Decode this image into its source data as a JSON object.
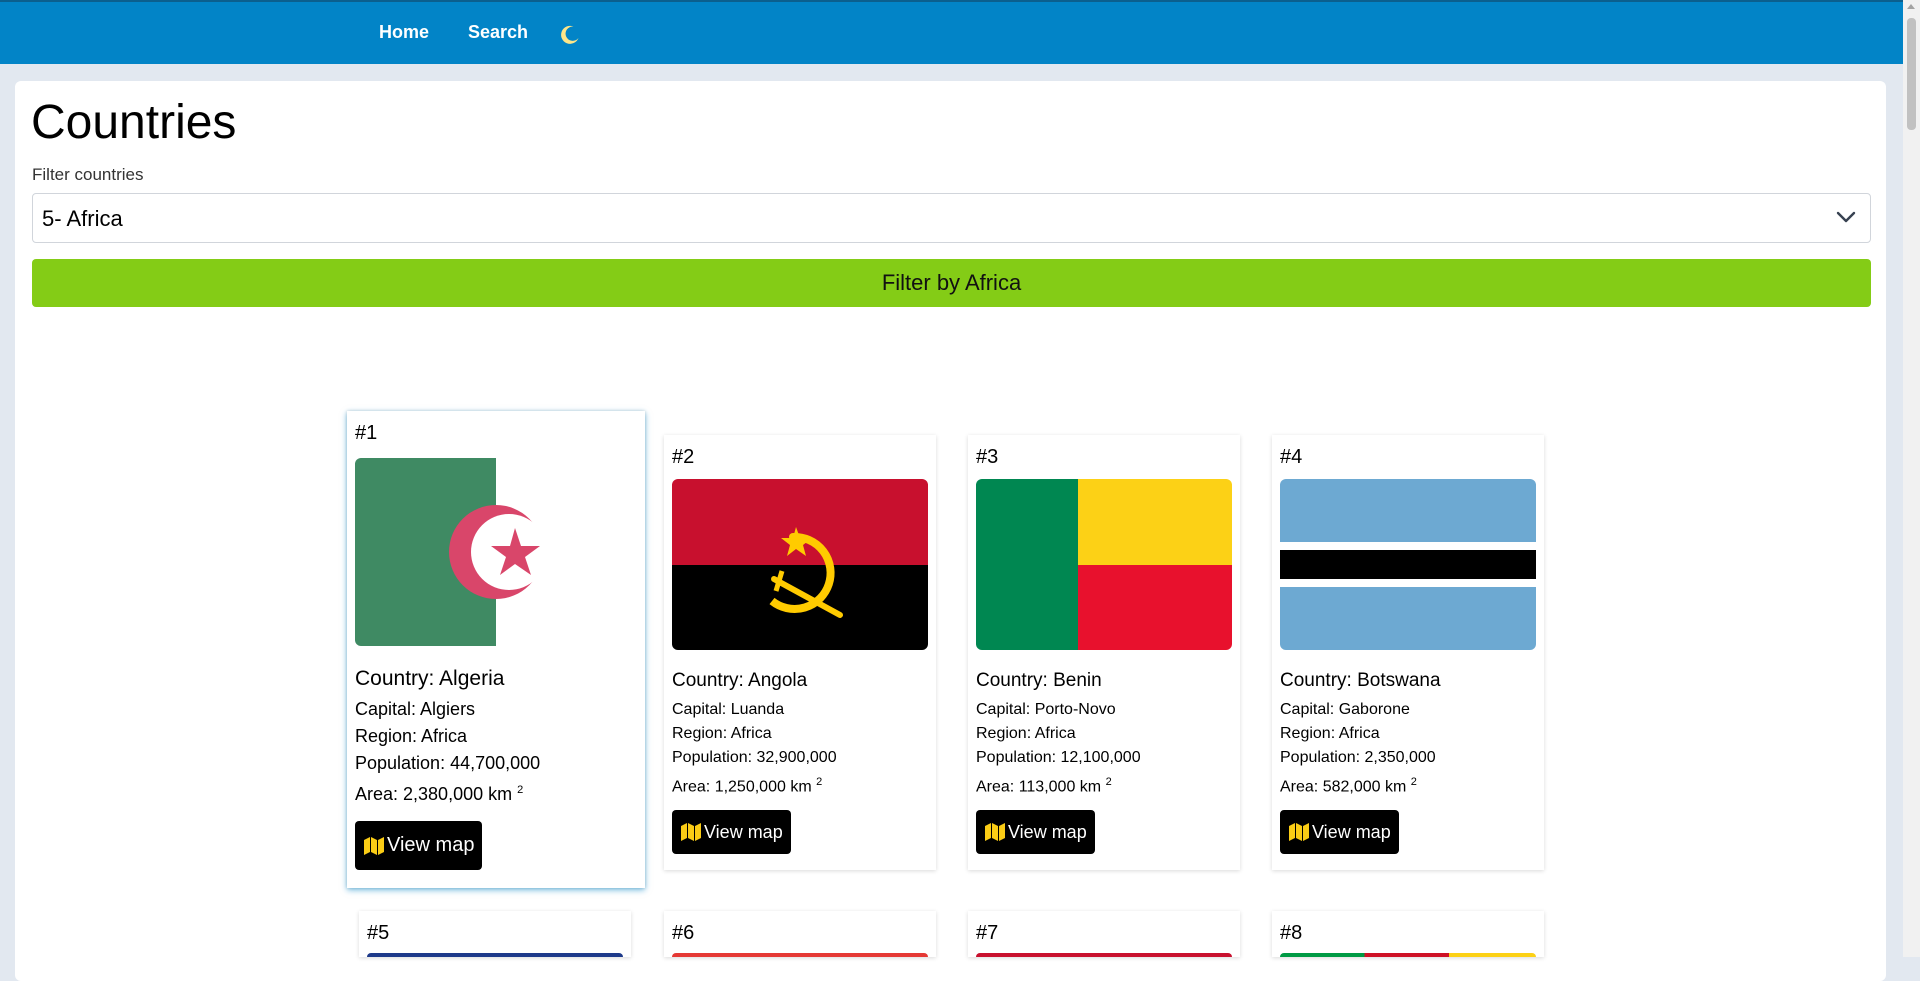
{
  "nav": {
    "home": "Home",
    "search": "Search",
    "theme_icon": "moon-icon"
  },
  "page": {
    "title": "Countries"
  },
  "filter": {
    "label": "Filter countries",
    "selected": "5- Africa",
    "button": "Filter by Africa"
  },
  "cards": [
    {
      "rank": "#1",
      "country": "Country: Algeria",
      "capital": "Capital: Algiers",
      "region": "Region: Africa",
      "population": "Population: 44,700,000",
      "area": "Area: 2,380,000 km",
      "area_sup": "2",
      "button": "View map"
    },
    {
      "rank": "#2",
      "country": "Country: Angola",
      "capital": "Capital: Luanda",
      "region": "Region: Africa",
      "population": "Population: 32,900,000",
      "area": "Area: 1,250,000 km",
      "area_sup": "2",
      "button": "View map"
    },
    {
      "rank": "#3",
      "country": "Country: Benin",
      "capital": "Capital: Porto-Novo",
      "region": "Region: Africa",
      "population": "Population: 12,100,000",
      "area": "Area: 113,000 km",
      "area_sup": "2",
      "button": "View map"
    },
    {
      "rank": "#4",
      "country": "Country: Botswana",
      "capital": "Capital: Gaborone",
      "region": "Region: Africa",
      "population": "Population: 2,350,000",
      "area": "Area: 582,000 km",
      "area_sup": "2",
      "button": "View map"
    }
  ],
  "next_row": [
    {
      "rank": "#5"
    },
    {
      "rank": "#6"
    },
    {
      "rank": "#7"
    },
    {
      "rank": "#8"
    }
  ],
  "colors": {
    "navbar": "#0284c7",
    "filter_button": "#84cc16",
    "map_icon": "#facc15"
  }
}
